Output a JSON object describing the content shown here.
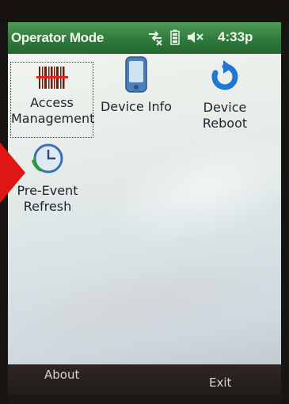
{
  "titlebar": {
    "title": "Operator Mode",
    "time": "4:33p",
    "icons": [
      "connectivity-icon",
      "battery-icon",
      "volume-muted-icon"
    ]
  },
  "tiles": [
    {
      "name": "access-management",
      "line1": "Access",
      "line2": "Management",
      "icon": "barcode-icon",
      "selected": true
    },
    {
      "name": "device-info",
      "line1": "Device Info",
      "line2": "",
      "icon": "pda-device-icon"
    },
    {
      "name": "device-reboot",
      "line1": "Device",
      "line2": "Reboot",
      "icon": "refresh-arrow-icon"
    },
    {
      "name": "pre-event-refresh",
      "line1": "Pre-Event",
      "line2": "Refresh",
      "icon": "clock-refresh-icon"
    }
  ],
  "softkeys": {
    "left": "About",
    "right": "Exit"
  },
  "colors": {
    "titlebar": "#2f7a3c",
    "pointer": "#e01515",
    "softbar": "#221c19"
  }
}
